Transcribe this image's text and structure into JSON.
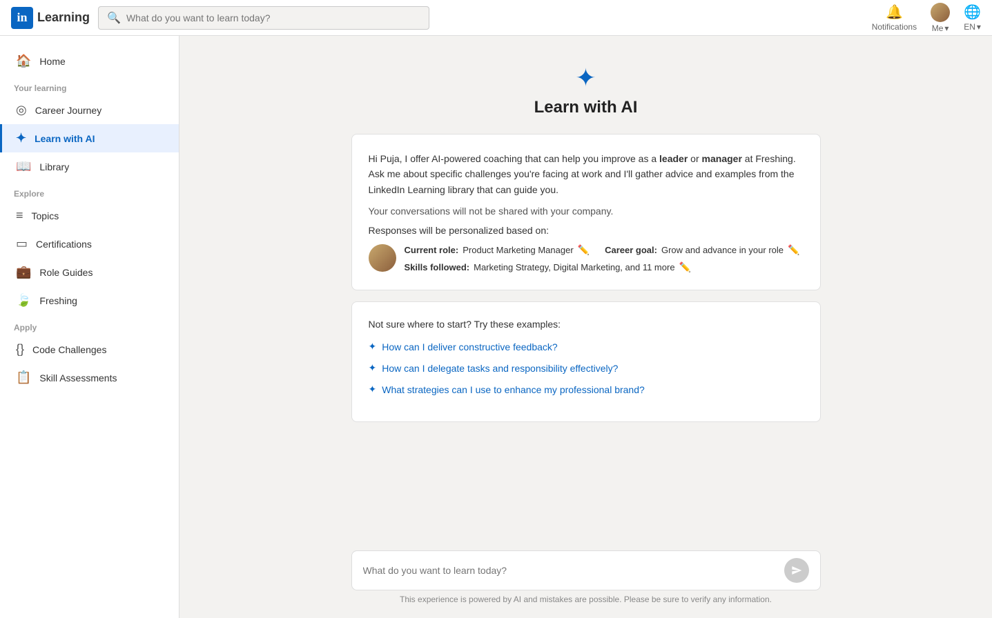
{
  "topnav": {
    "logo_letter": "in",
    "logo_text": "Learning",
    "search_placeholder": "What do you want to learn today?",
    "notifications_label": "Notifications",
    "me_label": "Me",
    "lang_label": "EN"
  },
  "sidebar": {
    "home_label": "Home",
    "sections": [
      {
        "label": "Your learning",
        "items": [
          {
            "id": "career-journey",
            "label": "Career Journey",
            "icon": "◎"
          },
          {
            "id": "learn-with-ai",
            "label": "Learn with AI",
            "icon": "✦",
            "active": true
          },
          {
            "id": "library",
            "label": "Library",
            "icon": "📖"
          }
        ]
      },
      {
        "label": "Explore",
        "items": [
          {
            "id": "topics",
            "label": "Topics",
            "icon": "≡"
          },
          {
            "id": "certifications",
            "label": "Certifications",
            "icon": "▭"
          },
          {
            "id": "role-guides",
            "label": "Role Guides",
            "icon": "💼"
          },
          {
            "id": "freshing",
            "label": "Freshing",
            "icon": "🍃"
          }
        ]
      },
      {
        "label": "Apply",
        "items": [
          {
            "id": "code-challenges",
            "label": "Code Challenges",
            "icon": "{}"
          },
          {
            "id": "skill-assessments",
            "label": "Skill Assessments",
            "icon": "📋"
          }
        ]
      }
    ]
  },
  "main": {
    "page_title": "Learn with AI",
    "intro_line1_pre": "Hi Puja, I offer AI-powered coaching that can help you improve as a ",
    "intro_bold1": "leader",
    "intro_middle": " or ",
    "intro_bold2": "manager",
    "intro_at": " at Freshing.",
    "intro_line2": "Ask me about specific challenges you're facing at work and I'll gather advice and examples from the LinkedIn Learning library that can guide you.",
    "privacy_note": "Your conversations will not be shared with your company.",
    "personalization_note": "Responses will be personalized based on:",
    "current_role_label": "Current role:",
    "current_role_value": "Product Marketing Manager",
    "career_goal_label": "Career goal:",
    "career_goal_value": "Grow and advance in your role",
    "skills_label": "Skills followed:",
    "skills_value": "Marketing Strategy, Digital Marketing, and 11 more",
    "examples_intro": "Not sure where to start? Try these examples:",
    "examples": [
      "How can I deliver constructive feedback?",
      "How can I delegate tasks and responsibility effectively?",
      "What strategies can I use to enhance my professional brand?"
    ],
    "chat_placeholder": "What do you want to learn today?",
    "disclaimer": "This experience is powered by AI and mistakes are possible. Please be sure to verify any information."
  }
}
